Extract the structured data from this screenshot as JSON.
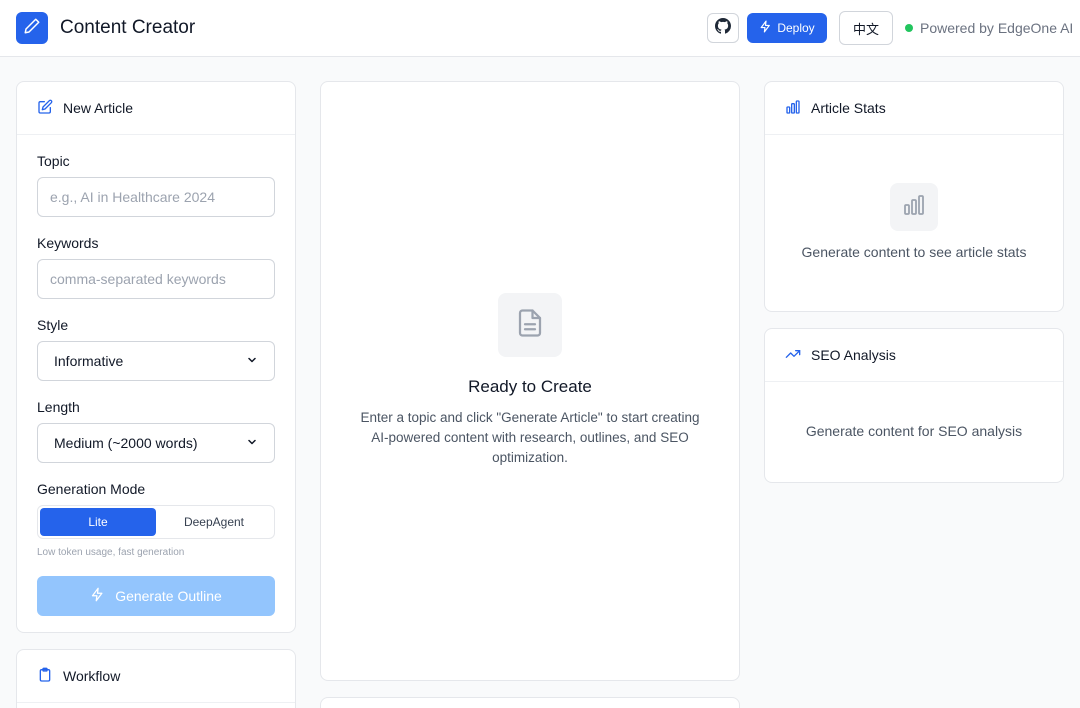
{
  "header": {
    "app_title": "Content Creator",
    "deploy_label": "Deploy",
    "language_label": "中文",
    "powered_by": "Powered by EdgeOne AI"
  },
  "new_article": {
    "title": "New Article",
    "topic_label": "Topic",
    "topic_placeholder": "e.g., AI in Healthcare 2024",
    "topic_value": "",
    "keywords_label": "Keywords",
    "keywords_placeholder": "comma-separated keywords",
    "keywords_value": "",
    "style_label": "Style",
    "style_value": "Informative",
    "length_label": "Length",
    "length_value": "Medium (~2000 words)",
    "mode_label": "Generation Mode",
    "mode_options": [
      "Lite",
      "DeepAgent"
    ],
    "mode_selected": "Lite",
    "mode_hint": "Low token usage, fast generation",
    "generate_label": "Generate Outline"
  },
  "workflow": {
    "title": "Workflow"
  },
  "main": {
    "empty_title": "Ready to Create",
    "empty_desc": "Enter a topic and click \"Generate Article\" to start creating AI-powered content with research, outlines, and SEO optimization."
  },
  "stats": {
    "title": "Article Stats",
    "empty_text": "Generate content to see article stats"
  },
  "seo": {
    "title": "SEO Analysis",
    "empty_text": "Generate content for SEO analysis"
  },
  "colors": {
    "primary": "#2563eb",
    "primary_disabled": "#93c5fd",
    "status_online": "#22c55e"
  },
  "icons": {
    "logo": "pencil-icon",
    "github": "github-icon",
    "deploy": "lightning-icon",
    "new_article": "edit-icon",
    "workflow": "clipboard-icon",
    "stats": "bar-chart-icon",
    "seo": "trending-up-icon",
    "empty_main": "document-icon"
  }
}
